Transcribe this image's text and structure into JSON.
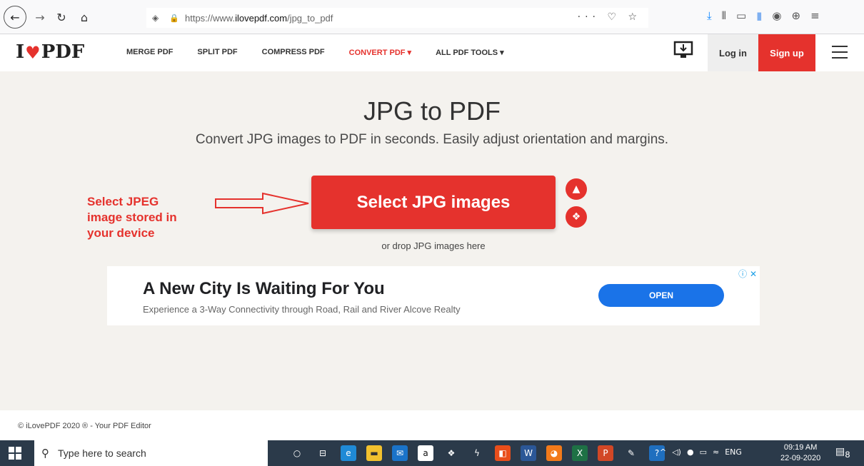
{
  "browser": {
    "url_prefix": "https://www.",
    "url_domain": "ilovepdf.com",
    "url_path": "/jpg_to_pdf",
    "page_actions": "··· ♡ ☆"
  },
  "site": {
    "logo_left": "I",
    "logo_right": "PDF",
    "menu": [
      "MERGE PDF",
      "SPLIT PDF",
      "COMPRESS PDF",
      "CONVERT PDF ▾",
      "ALL PDF TOOLS ▾"
    ],
    "login": "Log in",
    "signup": "Sign up",
    "accent_color": "#e5322d"
  },
  "hero": {
    "title": "JPG to PDF",
    "subtitle": "Convert JPG images to PDF in seconds. Easily adjust orientation and margins.",
    "button": "Select JPG images",
    "drop_text": "or drop JPG images here",
    "annotation_lines": [
      "Select JPEG",
      "image stored in",
      "your device"
    ]
  },
  "ad": {
    "title": "A New City Is Waiting For You",
    "subtitle": "Experience a 3-Way Connectivity through Road, Rail and River Alcove Realty",
    "cta": "OPEN"
  },
  "footer": {
    "text": "© iLovePDF 2020 ® - Your PDF Editor"
  },
  "taskbar": {
    "search_placeholder": "Type here to search",
    "lang": "ENG",
    "time": "09:19 AM",
    "date": "22-09-2020",
    "notifications": "8"
  }
}
